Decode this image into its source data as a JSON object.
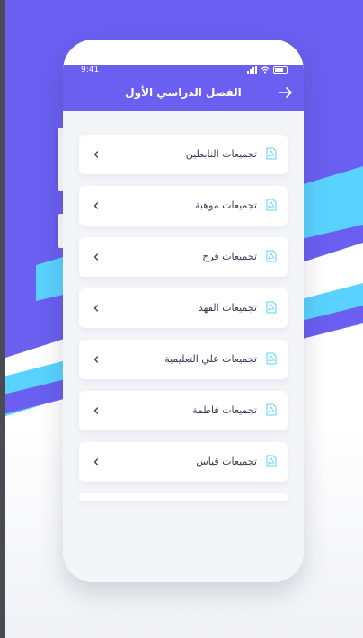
{
  "status_bar": {
    "time": "9:41"
  },
  "header": {
    "title": "الفصل الدراسي الأول"
  },
  "items": [
    {
      "label": "تجميعات النابطين"
    },
    {
      "label": "تجميعات موهبة"
    },
    {
      "label": "تجميعات فرح"
    },
    {
      "label": "تجميعات الفهد"
    },
    {
      "label": "تجميعات علي التعليمية"
    },
    {
      "label": "تجميعات فاطمة"
    },
    {
      "label": "تجميعات قياس"
    }
  ],
  "icons": {
    "item_leading": "pdf-file-icon",
    "item_trailing": "chevron-left-icon",
    "header_back": "arrow-right-icon"
  },
  "colors": {
    "header": "#6a5ff0",
    "accent_stripe": "#5ad2ff",
    "pdf_icon": "#5ad2ff",
    "text": "#3a3a55"
  }
}
